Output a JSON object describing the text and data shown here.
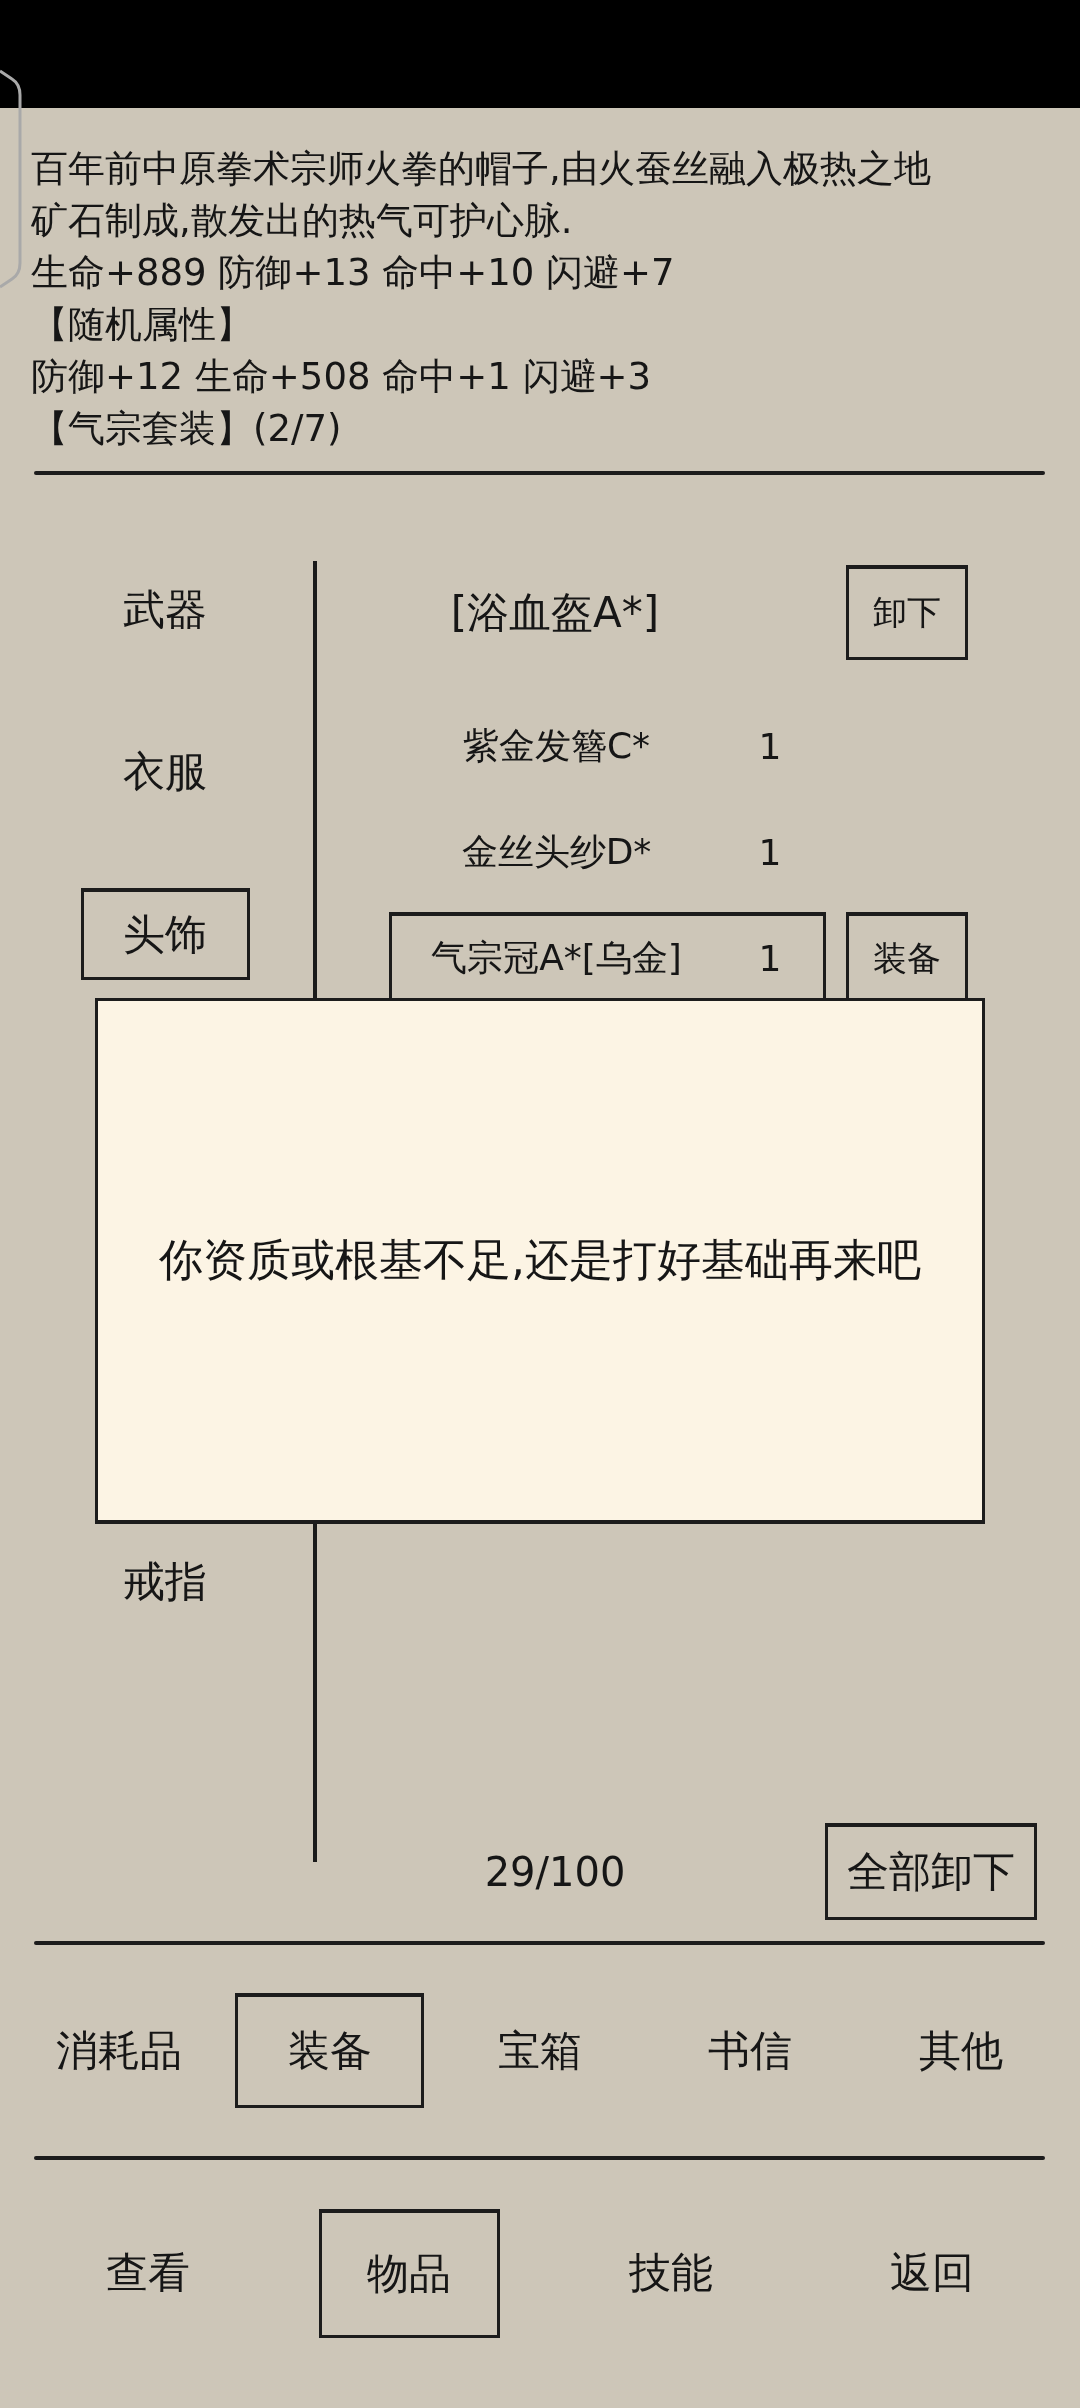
{
  "description": {
    "text": "百年前中原拳术宗师火拳的帽子,由火蚕丝融入极热之地矿石制成,散发出的热气可护心脉.",
    "lines": [
      "生命+889 防御+13 命中+10 闪避+7",
      "【随机属性】",
      "防御+12 生命+508 命中+1 闪避+3",
      "【气宗套装】(2/7)"
    ]
  },
  "categories": [
    {
      "label": "武器",
      "selected": false
    },
    {
      "label": "衣服",
      "selected": false
    },
    {
      "label": "头饰",
      "selected": true
    },
    {
      "label": "戒指",
      "selected": false
    }
  ],
  "equipped": {
    "name": "[浴血盔A*]",
    "button": "卸下"
  },
  "items": [
    {
      "name": "紫金发簪C*",
      "count": "1",
      "selected": false
    },
    {
      "name": "金丝头纱D*",
      "count": "1",
      "selected": false
    },
    {
      "name": "气宗冠A*[乌金]",
      "count": "1",
      "selected": true,
      "button": "装备"
    }
  ],
  "capacity": "29/100",
  "unequip_all": "全部卸下",
  "item_tabs": [
    {
      "label": "消耗品",
      "selected": false
    },
    {
      "label": "装备",
      "selected": true
    },
    {
      "label": "宝箱",
      "selected": false
    },
    {
      "label": "书信",
      "selected": false
    },
    {
      "label": "其他",
      "selected": false
    }
  ],
  "nav_tabs": [
    {
      "label": "查看",
      "selected": false
    },
    {
      "label": "物品",
      "selected": true
    },
    {
      "label": "技能",
      "selected": false
    },
    {
      "label": "返回",
      "selected": false
    }
  ],
  "dialog": {
    "message": "你资质或根基不足,还是打好基础再来吧"
  }
}
